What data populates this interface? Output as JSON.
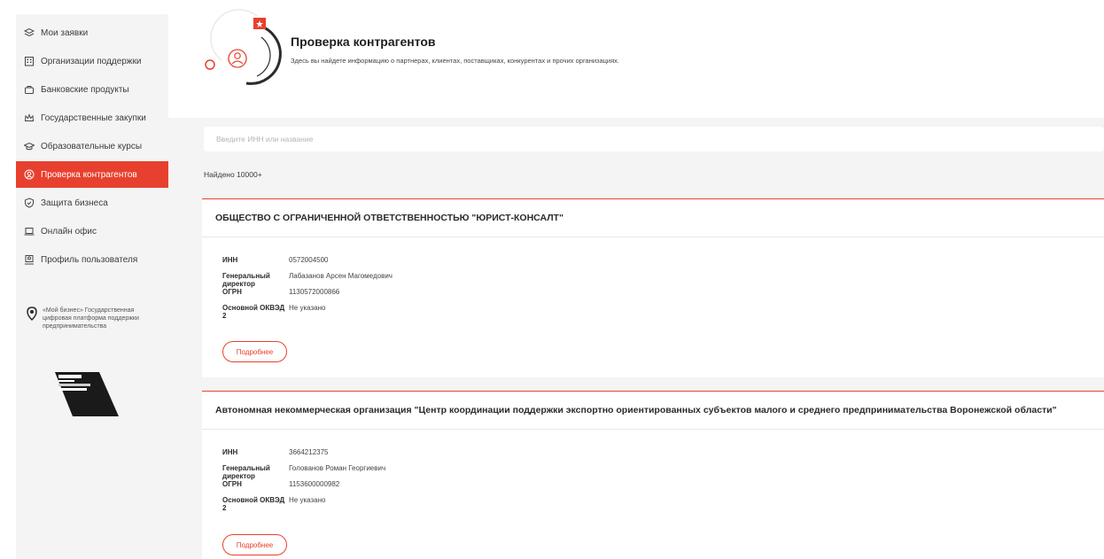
{
  "sidebar": {
    "items": [
      {
        "label": "Мои заявки",
        "icon": "layers-icon"
      },
      {
        "label": "Организации поддержки",
        "icon": "building-icon"
      },
      {
        "label": "Банковские продукты",
        "icon": "briefcase-icon"
      },
      {
        "label": "Государственные закупки",
        "icon": "crown-icon"
      },
      {
        "label": "Образовательные курсы",
        "icon": "graduation-cap-icon"
      },
      {
        "label": "Проверка контрагентов",
        "icon": "search-person-icon",
        "active": true
      },
      {
        "label": "Защита бизнеса",
        "icon": "shield-icon"
      },
      {
        "label": "Онлайн офис",
        "icon": "laptop-icon"
      },
      {
        "label": "Профиль пользователя",
        "icon": "profile-icon"
      }
    ],
    "promo_text": "«Мой бизнес» Государственная цифровая платформа поддержки предпринимательства"
  },
  "header": {
    "title": "Проверка контрагентов",
    "subtitle": "Здесь вы найдете информацию о партнерах, клиентах, поставщиках, конкурентах и прочих организациях."
  },
  "search": {
    "placeholder": "Введите ИНН или название"
  },
  "found": "Найдено 10000+",
  "labels": {
    "inn": "ИНН",
    "director": "Генеральный директор",
    "ogrn": "ОГРН",
    "okved": "Основной ОКВЭД 2",
    "more": "Подробнее"
  },
  "results": [
    {
      "name": "ОБЩЕСТВО С ОГРАНИЧЕННОЙ ОТВЕТСТВЕННОСТЬЮ \"ЮРИСТ-КОНСАЛТ\"",
      "inn": "0572004500",
      "director": "Лабазанов Арсен Магомедович",
      "ogrn": "1130572000866",
      "okved": "Не указано"
    },
    {
      "name": "Автономная некоммерческая организация \"Центр координации поддержки экспортно ориентированных субъектов малого и среднего предпринимательства Воронежской области\"",
      "inn": "3664212375",
      "director": "Голованов Роман Георгиевич",
      "ogrn": "1153600000982",
      "okved": "Не указано"
    }
  ],
  "colors": {
    "accent": "#e8402e",
    "sidebar_bg": "#f4f4f4",
    "text": "#2b2b2b"
  }
}
